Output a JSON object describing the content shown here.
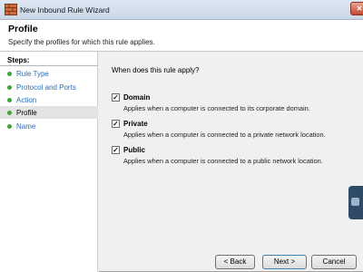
{
  "window": {
    "title": "New Inbound Rule Wizard",
    "close_label": "✕"
  },
  "header": {
    "title": "Profile",
    "subtitle": "Specify the profiles for which this rule applies."
  },
  "steps": {
    "title": "Steps:",
    "items": [
      {
        "label": "Rule Type"
      },
      {
        "label": "Protocol and Ports"
      },
      {
        "label": "Action"
      },
      {
        "label": "Profile"
      },
      {
        "label": "Name"
      }
    ]
  },
  "main": {
    "question": "When does this rule apply?",
    "options": [
      {
        "name": "Domain",
        "description": "Applies when a computer is connected to its corporate domain.",
        "checked": true
      },
      {
        "name": "Private",
        "description": "Applies when a computer is connected to a private network location.",
        "checked": true
      },
      {
        "name": "Public",
        "description": "Applies when a computer is connected to a public network location.",
        "checked": true
      }
    ],
    "check_mark": "✓"
  },
  "buttons": {
    "back": "< Back",
    "next": "Next >",
    "cancel": "Cancel"
  },
  "colors": {
    "step_dot": "#3fa43a",
    "step_link": "#2e6db5",
    "close_button": "#c5452d"
  }
}
